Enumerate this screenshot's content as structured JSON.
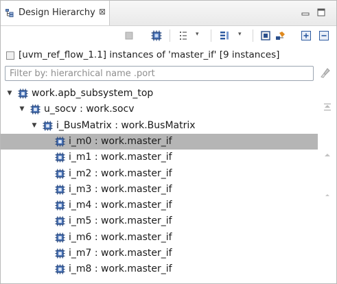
{
  "window": {
    "tab_title": "Design Hierarchy",
    "tab_close_glyph": "⊠"
  },
  "info": {
    "text": "[uvm_ref_flow_1.1] instances of 'master_if' [9 instances]"
  },
  "filter": {
    "placeholder": "Filter by: hierarchical name .port",
    "value": ""
  },
  "tree": {
    "selected_index": 3,
    "rows": [
      {
        "label": "work.apb_subsystem_top",
        "depth": 0,
        "expanded": true,
        "has_children": true
      },
      {
        "label": "u_socv : work.socv",
        "depth": 1,
        "expanded": true,
        "has_children": true
      },
      {
        "label": "i_BusMatrix : work.BusMatrix",
        "depth": 2,
        "expanded": true,
        "has_children": true
      },
      {
        "label": "i_m0 : work.master_if",
        "depth": 3,
        "expanded": false,
        "has_children": false
      },
      {
        "label": "i_m1 : work.master_if",
        "depth": 3,
        "expanded": false,
        "has_children": false
      },
      {
        "label": "i_m2 : work.master_if",
        "depth": 3,
        "expanded": false,
        "has_children": false
      },
      {
        "label": "i_m3 : work.master_if",
        "depth": 3,
        "expanded": false,
        "has_children": false
      },
      {
        "label": "i_m4 : work.master_if",
        "depth": 3,
        "expanded": false,
        "has_children": false
      },
      {
        "label": "i_m5 : work.master_if",
        "depth": 3,
        "expanded": false,
        "has_children": false
      },
      {
        "label": "i_m6 : work.master_if",
        "depth": 3,
        "expanded": false,
        "has_children": false
      },
      {
        "label": "i_m7 : work.master_if",
        "depth": 3,
        "expanded": false,
        "has_children": false
      },
      {
        "label": "i_m8 : work.master_if",
        "depth": 3,
        "expanded": false,
        "has_children": false
      }
    ]
  },
  "colors": {
    "selection": "#b5b5b5",
    "chip_blue": "#2a4f8c",
    "toolbar_orange": "#e08a1e"
  }
}
